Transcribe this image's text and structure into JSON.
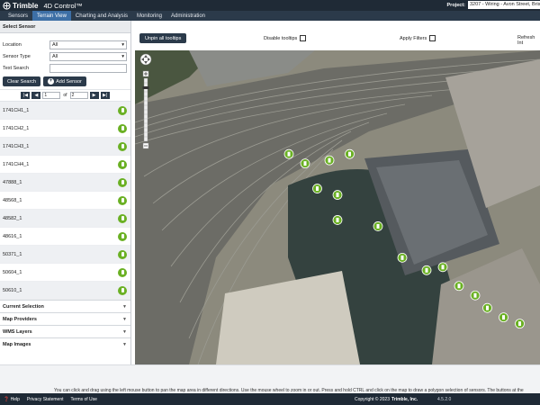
{
  "brand": {
    "logo_text": "Trimble",
    "product": "4D Control™"
  },
  "project": {
    "label": "Project:",
    "value": "3207 - Wiring - Avon Street, Bristol"
  },
  "nav": {
    "items": [
      "Sensors",
      "Terrain View",
      "Charting and Analysis",
      "Monitoring",
      "Administration"
    ],
    "active": "Terrain View"
  },
  "sidebar": {
    "title": "Select Sensor",
    "filters": [
      {
        "label": "Location",
        "value": "All"
      },
      {
        "label": "Sensor Type",
        "value": "All"
      }
    ],
    "text_search": {
      "label": "Text Search",
      "value": ""
    },
    "clear_search_label": "Clear Search",
    "add_sensor_label": "Add Sensor",
    "pager": {
      "current": "1",
      "of_label": "of",
      "total": "2"
    },
    "sensors": [
      "1741CH1_1",
      "1741CH2_1",
      "1741CH3_1",
      "1741CH4_1",
      "47888_1",
      "48568_1",
      "48582_1",
      "48616_1",
      "50371_1",
      "50604_1",
      "50610_1"
    ],
    "sections": [
      "Current Selection",
      "Map Providers",
      "WMS Layers",
      "Map Images"
    ]
  },
  "map": {
    "unpin_label": "Unpin all tooltips",
    "disable_tooltips_label": "Disable tooltips",
    "apply_filters_label": "Apply Filters",
    "refresh_label": "Refresh Int",
    "markers": [
      {
        "x": 0.38,
        "y": 0.33
      },
      {
        "x": 0.42,
        "y": 0.36
      },
      {
        "x": 0.48,
        "y": 0.35
      },
      {
        "x": 0.53,
        "y": 0.33
      },
      {
        "x": 0.45,
        "y": 0.44
      },
      {
        "x": 0.5,
        "y": 0.46
      },
      {
        "x": 0.5,
        "y": 0.54
      },
      {
        "x": 0.6,
        "y": 0.56
      },
      {
        "x": 0.66,
        "y": 0.66
      },
      {
        "x": 0.72,
        "y": 0.7
      },
      {
        "x": 0.76,
        "y": 0.69
      },
      {
        "x": 0.8,
        "y": 0.75
      },
      {
        "x": 0.84,
        "y": 0.78
      },
      {
        "x": 0.87,
        "y": 0.82
      },
      {
        "x": 0.91,
        "y": 0.85
      },
      {
        "x": 0.95,
        "y": 0.87
      }
    ]
  },
  "status": {
    "message": "You can click and drag using the left mouse button to pan the map area in different directions. Use the mouse wheel to zoom in or out. Press and hold CTRL and click on the map to draw a polygon selection of sensors. The buttons at the"
  },
  "footer": {
    "help": "Help",
    "privacy": "Privacy Statement",
    "terms": "Terms of Use",
    "copyright": "Copyright © 2023",
    "company": "Trimble, Inc.",
    "version": "4.5.2.0"
  },
  "colors": {
    "header": "#1f2a36",
    "nav": "#2b3a4a",
    "active_tab": "#3d6fa6",
    "sensor_green": "#6ab023"
  }
}
